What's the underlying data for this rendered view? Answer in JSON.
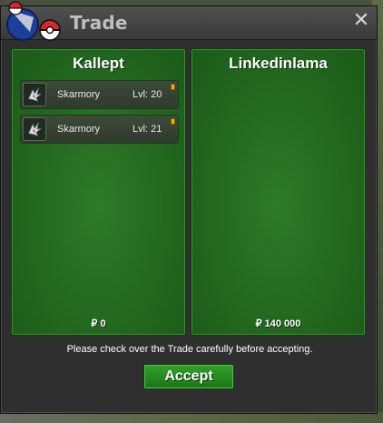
{
  "window": {
    "title": "Trade",
    "close_glyph": "✕"
  },
  "left_panel": {
    "player": "Kallept",
    "money": "₽ 0",
    "items": [
      {
        "name": "Skarmory",
        "level": "Lvl: 20",
        "icon": "skarmory-sprite-icon"
      },
      {
        "name": "Skarmory",
        "level": "Lvl: 21",
        "icon": "skarmory-sprite-icon"
      }
    ]
  },
  "right_panel": {
    "player": "Linkedinlama",
    "money": "₽ 140 000",
    "items": []
  },
  "notice": "Please check over the Trade carefully before accepting.",
  "accept_label": "Accept",
  "colors": {
    "panel_green": "#256b21",
    "accept_green": "#238a1f",
    "titlebar": "#3a3a3a",
    "window": "#2f2f2f",
    "item_flag": "#f0b000"
  }
}
